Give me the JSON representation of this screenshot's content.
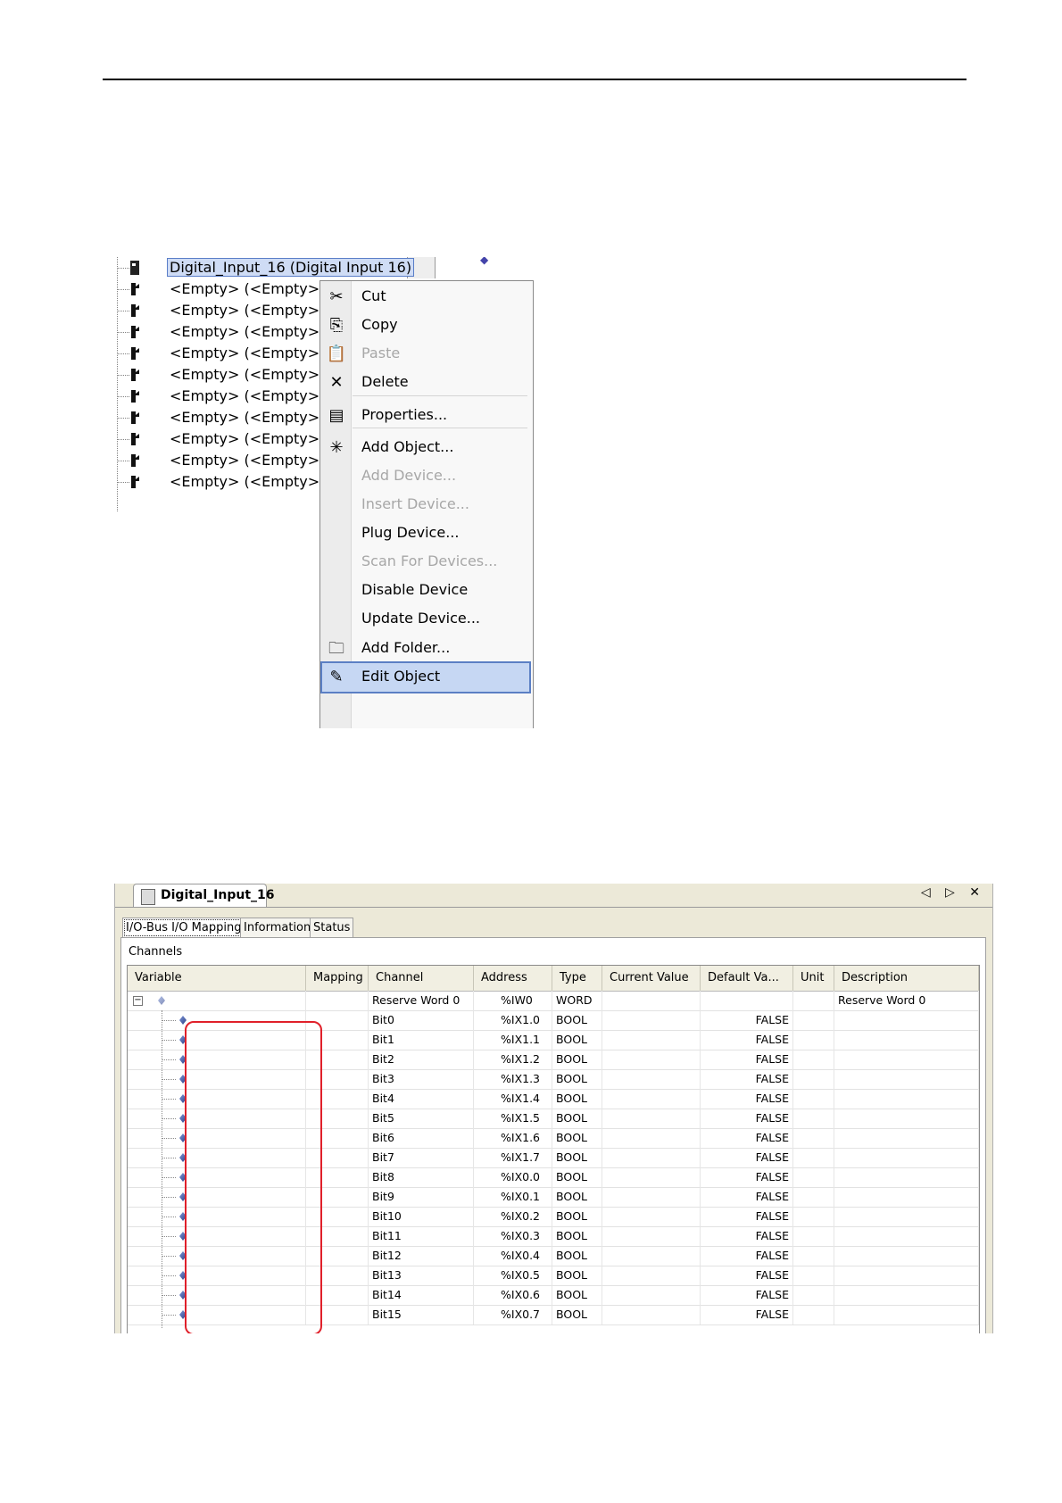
{
  "device_tree": {
    "selected_node": "Digital_Input_16 (Digital Input 16)",
    "empty_slots": [
      "<Empty> (<Empty>)",
      "<Empty> (<Empty>)",
      "<Empty> (<Empty>)",
      "<Empty> (<Empty>)",
      "<Empty> (<Empty>)",
      "<Empty> (<Empty>)",
      "<Empty> (<Empty>)",
      "<Empty> (<Empty>)",
      "<Empty> (<Empty>)",
      "<Empty> (<Empty>)"
    ]
  },
  "context_menu": {
    "items": [
      {
        "label": "Cut",
        "icon": "scissors-icon",
        "enabled": true
      },
      {
        "label": "Copy",
        "icon": "copy-icon",
        "enabled": true
      },
      {
        "label": "Paste",
        "icon": "paste-icon",
        "enabled": false
      },
      {
        "label": "Delete",
        "icon": "delete-icon",
        "enabled": true
      },
      {
        "label": "Properties...",
        "icon": "properties-icon",
        "enabled": true
      },
      {
        "label": "Add Object...",
        "icon": "add-object-icon",
        "enabled": true
      },
      {
        "label": "Add Device...",
        "icon": "",
        "enabled": false
      },
      {
        "label": "Insert Device...",
        "icon": "",
        "enabled": false
      },
      {
        "label": "Plug Device...",
        "icon": "",
        "enabled": true
      },
      {
        "label": "Scan For Devices...",
        "icon": "",
        "enabled": false
      },
      {
        "label": "Disable Device",
        "icon": "",
        "enabled": true
      },
      {
        "label": "Update Device...",
        "icon": "",
        "enabled": true
      },
      {
        "label": "Add Folder...",
        "icon": "folder-icon",
        "enabled": true
      },
      {
        "label": "Edit Object",
        "icon": "edit-object-icon",
        "enabled": true,
        "highlighted": true
      }
    ]
  },
  "editor": {
    "doc_tab_title": "Digital_Input_16",
    "window_controls": "◁ ▷ ✕",
    "tabs": [
      "I/O-Bus I/O Mapping",
      "Information",
      "Status"
    ],
    "active_tab": "I/O-Bus I/O Mapping",
    "section_label": "Channels",
    "columns": [
      "Variable",
      "Mapping",
      "Channel",
      "Address",
      "Type",
      "Current Value",
      "Default Va...",
      "Unit",
      "Description"
    ],
    "parent_row": {
      "channel": "Reserve Word 0",
      "address": "%IW0",
      "type": "WORD",
      "description": "Reserve Word 0"
    },
    "rows": [
      {
        "channel": "Bit0",
        "address": "%IX1.0",
        "type": "BOOL",
        "default": "FALSE"
      },
      {
        "channel": "Bit1",
        "address": "%IX1.1",
        "type": "BOOL",
        "default": "FALSE"
      },
      {
        "channel": "Bit2",
        "address": "%IX1.2",
        "type": "BOOL",
        "default": "FALSE"
      },
      {
        "channel": "Bit3",
        "address": "%IX1.3",
        "type": "BOOL",
        "default": "FALSE"
      },
      {
        "channel": "Bit4",
        "address": "%IX1.4",
        "type": "BOOL",
        "default": "FALSE"
      },
      {
        "channel": "Bit5",
        "address": "%IX1.5",
        "type": "BOOL",
        "default": "FALSE"
      },
      {
        "channel": "Bit6",
        "address": "%IX1.6",
        "type": "BOOL",
        "default": "FALSE"
      },
      {
        "channel": "Bit7",
        "address": "%IX1.7",
        "type": "BOOL",
        "default": "FALSE"
      },
      {
        "channel": "Bit8",
        "address": "%IX0.0",
        "type": "BOOL",
        "default": "FALSE"
      },
      {
        "channel": "Bit9",
        "address": "%IX0.1",
        "type": "BOOL",
        "default": "FALSE"
      },
      {
        "channel": "Bit10",
        "address": "%IX0.2",
        "type": "BOOL",
        "default": "FALSE"
      },
      {
        "channel": "Bit11",
        "address": "%IX0.3",
        "type": "BOOL",
        "default": "FALSE"
      },
      {
        "channel": "Bit12",
        "address": "%IX0.4",
        "type": "BOOL",
        "default": "FALSE"
      },
      {
        "channel": "Bit13",
        "address": "%IX0.5",
        "type": "BOOL",
        "default": "FALSE"
      },
      {
        "channel": "Bit14",
        "address": "%IX0.6",
        "type": "BOOL",
        "default": "FALSE"
      },
      {
        "channel": "Bit15",
        "address": "%IX0.7",
        "type": "BOOL",
        "default": "FALSE"
      }
    ],
    "highlight_color": "#e0202a"
  }
}
